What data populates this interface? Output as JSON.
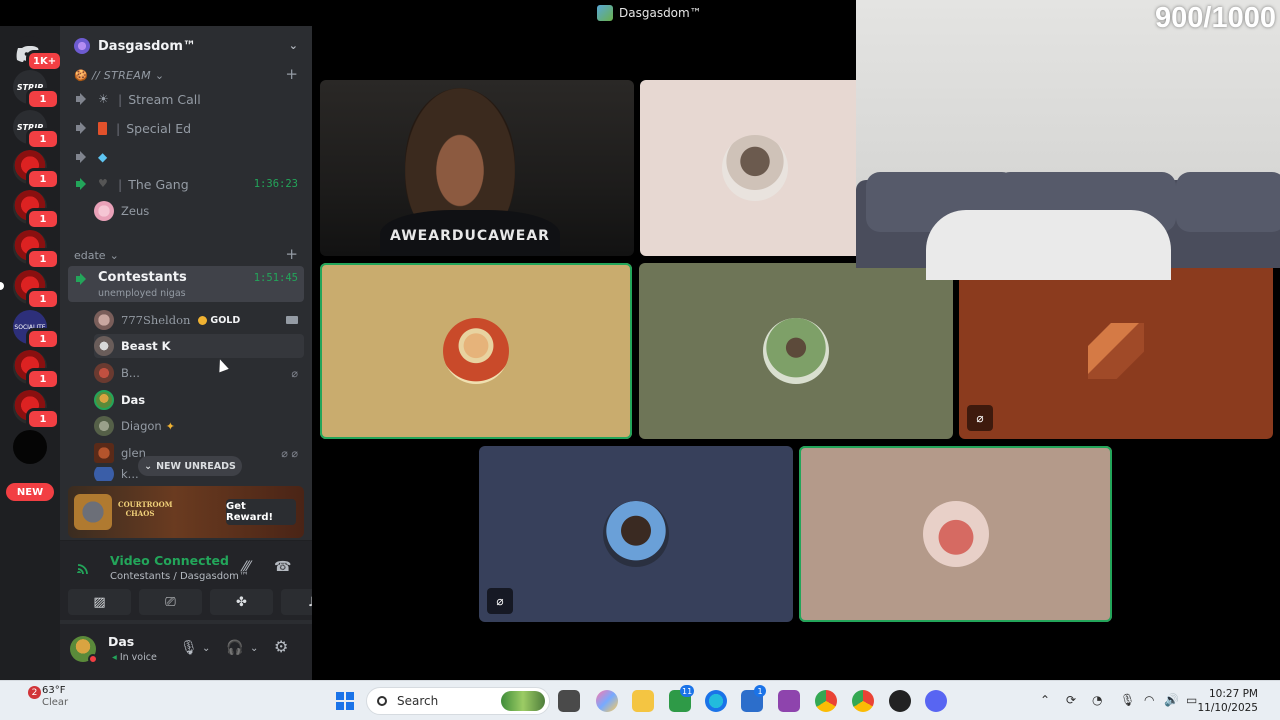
{
  "window": {
    "title": "Dasgasdom™"
  },
  "rail": {
    "home_badge": "1K+",
    "servers": [
      {
        "label": "STRIP",
        "badge": "1"
      },
      {
        "label": "STRIP",
        "badge": "1"
      },
      {
        "label": "",
        "badge": "1"
      },
      {
        "label": "",
        "badge": "1"
      },
      {
        "label": "",
        "badge": "1"
      },
      {
        "label": "",
        "badge": "1"
      },
      {
        "label": "SOCIALITE",
        "badge": "1"
      },
      {
        "label": "",
        "badge": "1"
      },
      {
        "label": "",
        "badge": "1"
      }
    ],
    "new_label": "NEW"
  },
  "sidebar": {
    "guild_name": "Dasgasdom™",
    "category_stream": "// STREAM",
    "channels": [
      {
        "name": "Stream Call"
      },
      {
        "name": "Special Ed"
      },
      {
        "name": ""
      },
      {
        "name": "The Gang",
        "timer": "1:36:23"
      }
    ],
    "gang_user": "Zeus",
    "category_edate": "edate",
    "active_channel": {
      "name": "Contestants",
      "timer": "1:51:45",
      "subtitle": "unemployed nigas"
    },
    "users": [
      {
        "name": "777Sheldon",
        "tag": "GOLD"
      },
      {
        "name": "Beast K"
      },
      {
        "name": "B..."
      },
      {
        "name": "Das"
      },
      {
        "name": "Diagon"
      },
      {
        "name": "glen"
      },
      {
        "name": "k..."
      }
    ],
    "new_unreads": "NEW UNREADS",
    "promo": {
      "title": "COURTROOM CHAOS",
      "button": "Get Reward!"
    },
    "voice": {
      "status": "Video Connected",
      "location": "Contestants / Dasgasdom™"
    },
    "user_panel": {
      "name": "Das",
      "status": "In voice"
    }
  },
  "stage": {
    "overlay_counter": "900/1000",
    "shirt_text": "AWEARDUCAWEAR"
  },
  "taskbar": {
    "weather_badge": "2",
    "temperature": "63°F",
    "condition": "Clear",
    "search_placeholder": "Search",
    "badges": [
      "11",
      "1"
    ],
    "time": "10:27 PM",
    "date": "11/10/2025"
  },
  "colors": {
    "accent_green": "#23a55a",
    "danger_red": "#f23f43",
    "sidebar_bg": "#2b2d31",
    "rail_bg": "#1e1f22"
  }
}
